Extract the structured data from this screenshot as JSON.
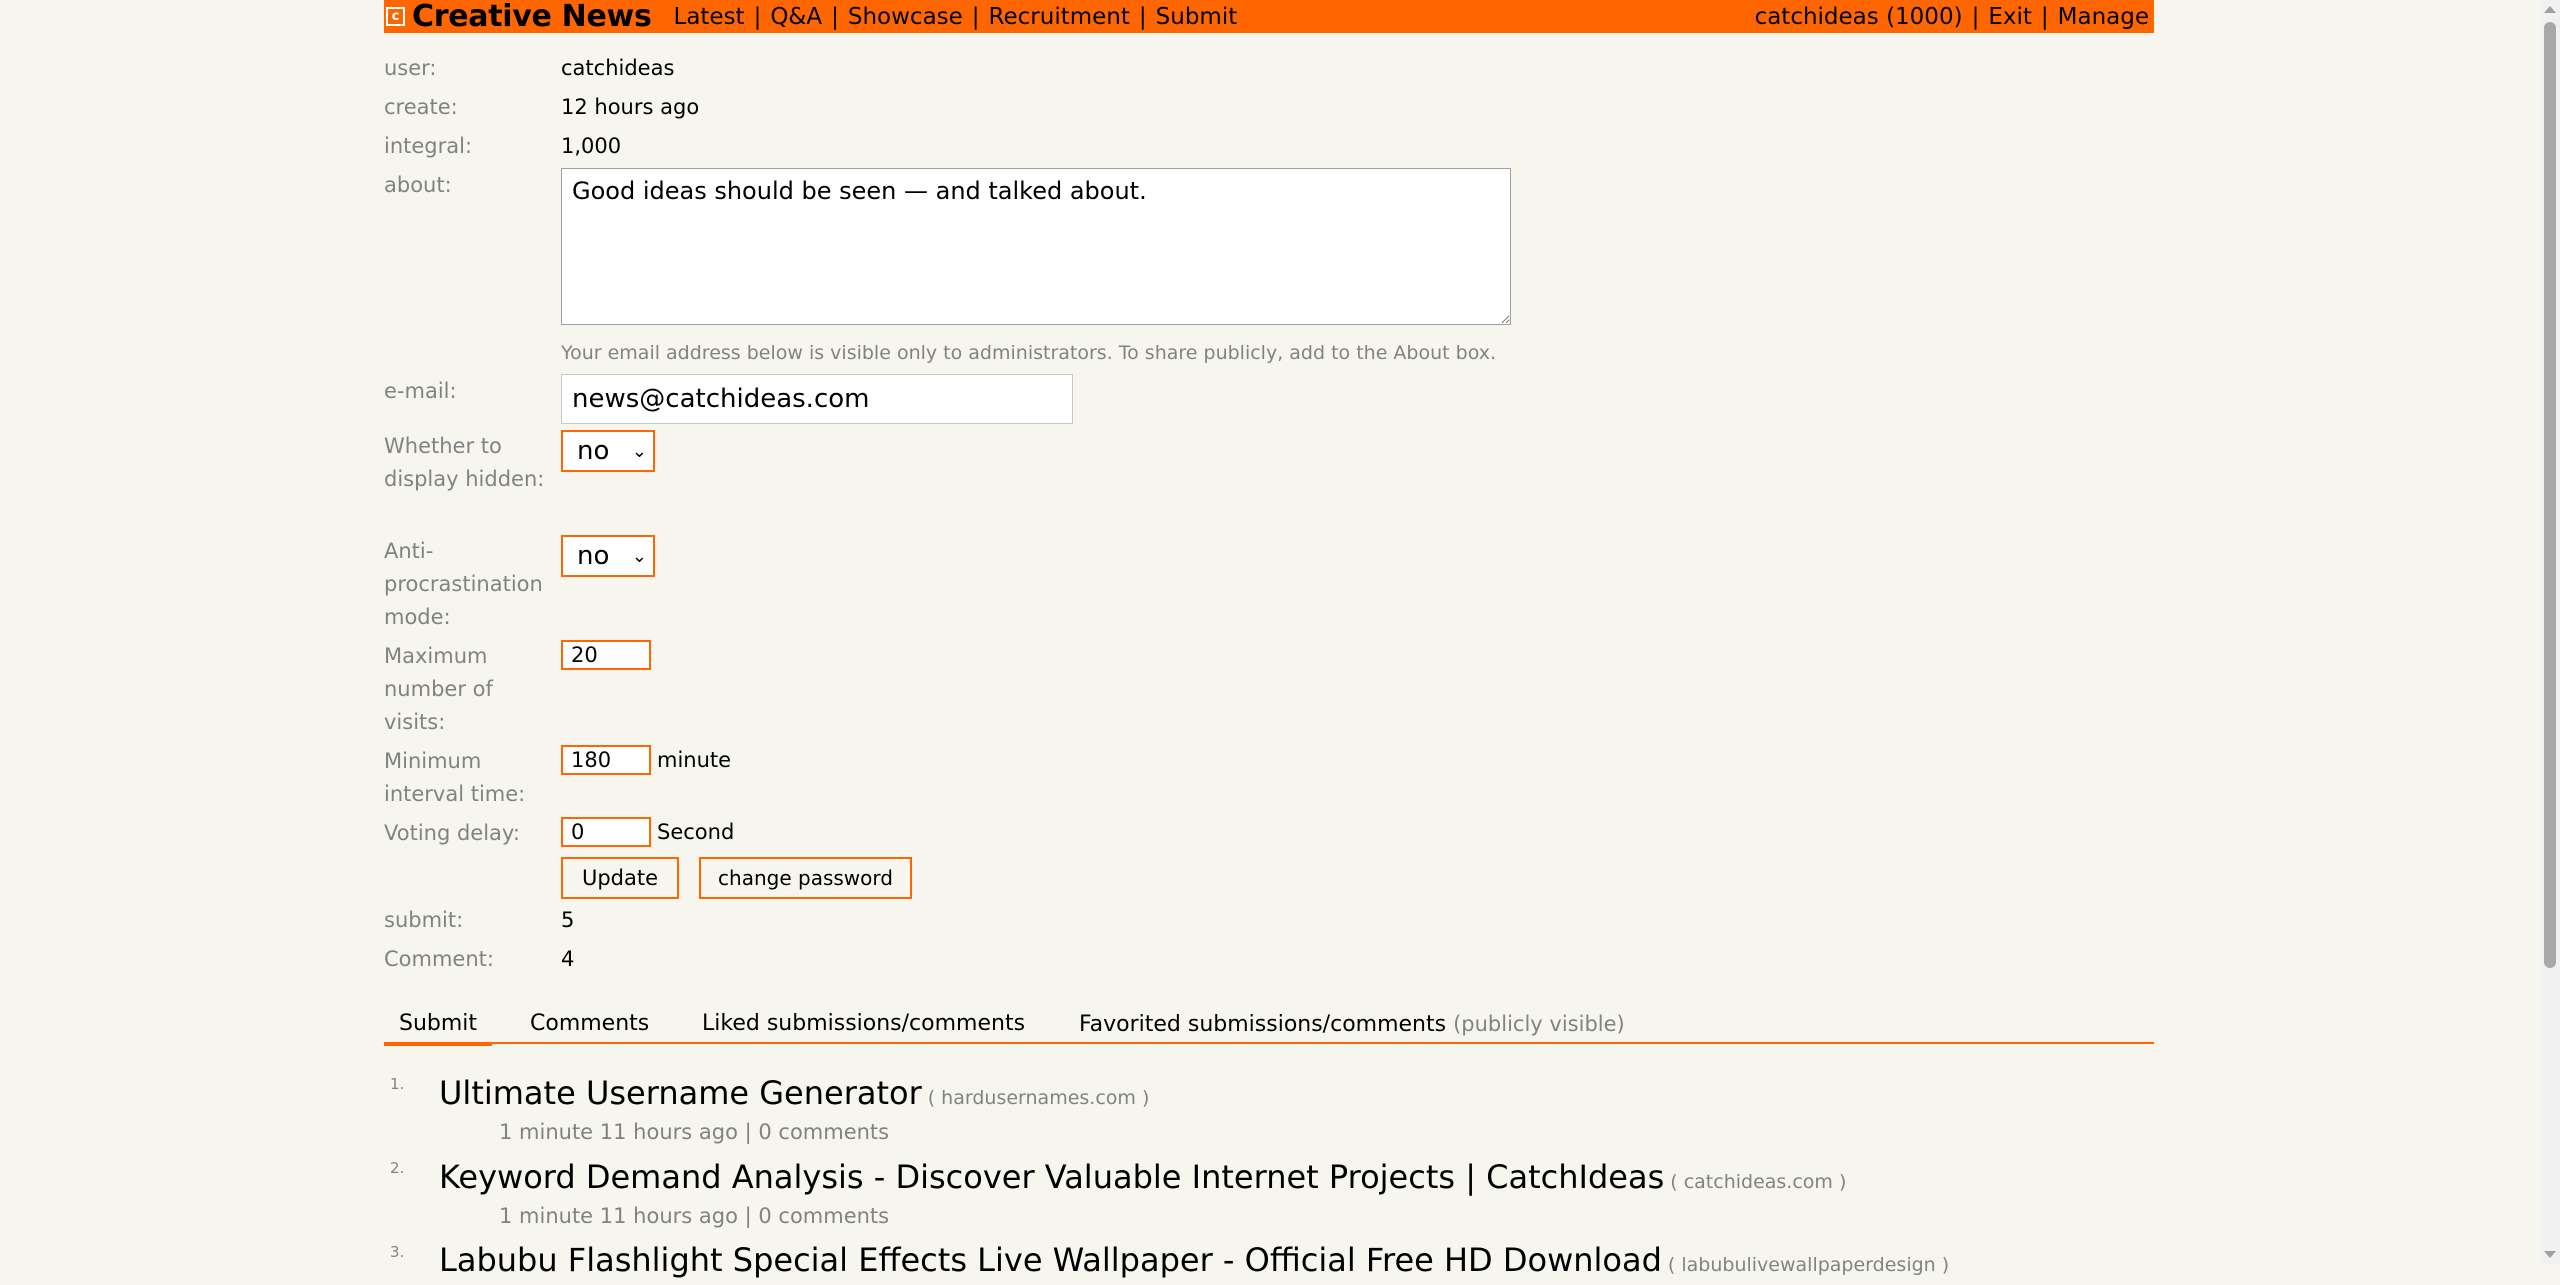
{
  "header": {
    "logo_letter": "c",
    "brand": "Creative News",
    "nav": [
      "Latest",
      "Q&A",
      "Showcase",
      "Recruitment",
      "Submit"
    ],
    "user_link": "catchideas (1000)",
    "exit": "Exit",
    "manage": "Manage"
  },
  "profile": {
    "user_label": "user:",
    "user_value": "catchideas",
    "create_label": "create:",
    "create_value": "12 hours ago",
    "integral_label": "integral:",
    "integral_value": "1,000",
    "about_label": "about:",
    "about_value": "Good ideas should be seen — and talked about.",
    "email_note": "Your email address below is visible only to administrators. To share publicly, add to the About box.",
    "email_label": "e-mail:",
    "email_value": "news@catchideas.com",
    "hidden_label": "Whether to display hidden:",
    "hidden_value": "no",
    "noprocrast_label": "Anti-procrastination mode:",
    "noprocrast_value": "no",
    "maxvisit_label": "Maximum number of visits:",
    "maxvisit_value": "20",
    "minaway_label": "Minimum interval time:",
    "minaway_value": "180",
    "minaway_unit": "minute",
    "delay_label": "Voting delay:",
    "delay_value": "0",
    "delay_unit": "Second",
    "update_button": "Update",
    "password_button": "change password",
    "submit_label": "submit:",
    "submit_value": "5",
    "comment_label": "Comment:",
    "comment_value": "4"
  },
  "tabs": {
    "submit": "Submit",
    "comments": "Comments",
    "liked": "Liked submissions/comments",
    "favorited": "Favorited submissions/comments",
    "favorited_note": "(publicly visible)"
  },
  "items": [
    {
      "rank": "1.",
      "title": "Ultimate Username Generator",
      "site": "( hardusernames.com )",
      "meta": "1 minute 11 hours ago | 0 comments"
    },
    {
      "rank": "2.",
      "title": "Keyword Demand Analysis - Discover Valuable Internet Projects | CatchIdeas",
      "site": "( catchideas.com )",
      "meta": "1 minute 11 hours ago | 0 comments"
    },
    {
      "rank": "3.",
      "title": "Labubu Flashlight Special Effects Live Wallpaper - Official Free HD Download",
      "site": "( labubulivewallpaperdesign )",
      "meta": ""
    }
  ],
  "colors": {
    "accent": "#ff6600",
    "background": "#f6f6ef",
    "muted": "#828282"
  }
}
